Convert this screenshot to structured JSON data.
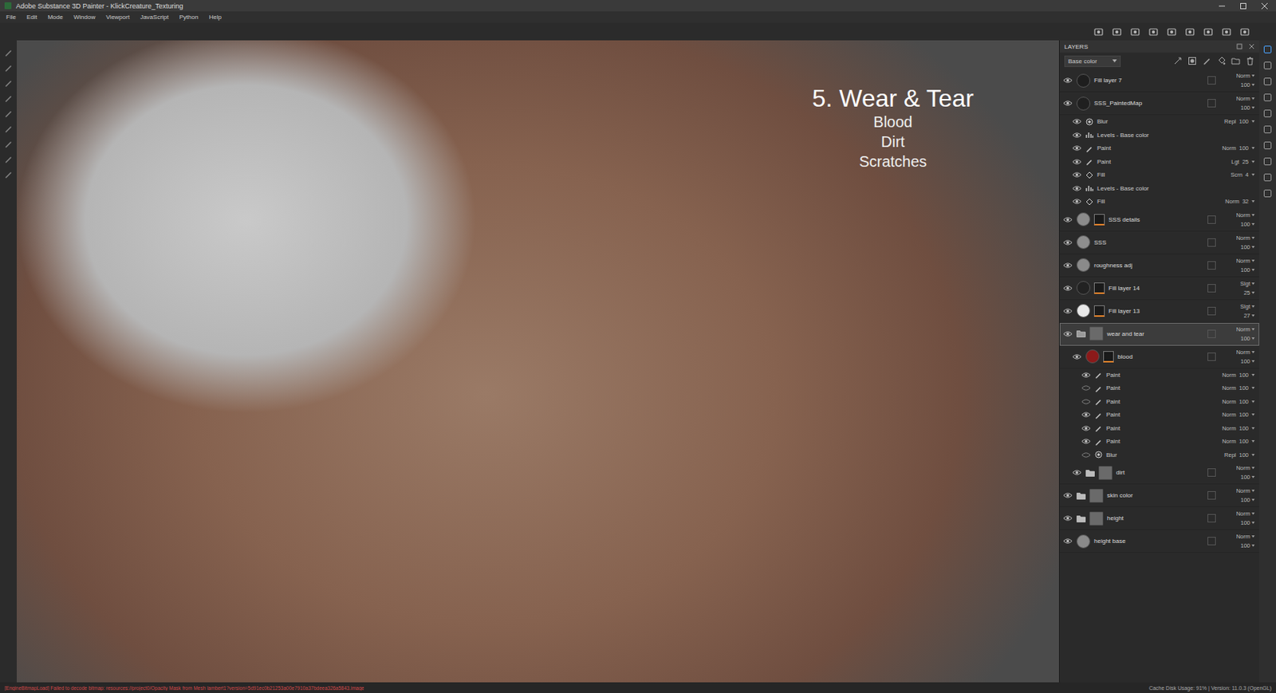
{
  "window": {
    "title": "Adobe Substance 3D Painter - KlickCreature_Texturing"
  },
  "menu": [
    "File",
    "Edit",
    "Mode",
    "Window",
    "Viewport",
    "JavaScript",
    "Python",
    "Help"
  ],
  "viewport": {
    "heading": "5. Wear & Tear",
    "lines": [
      "Blood",
      "Dirt",
      "Scratches"
    ]
  },
  "layers_panel": {
    "title": "LAYERS",
    "channel": "Base color",
    "layers": [
      {
        "name": "Fill layer 7",
        "kind": "fill",
        "visible": true,
        "selected": false,
        "blend": "Norm",
        "opacity": "100",
        "color": "#1e1e1e",
        "mask": false
      },
      {
        "name": "SSS_PaintedMap",
        "kind": "fill",
        "visible": true,
        "selected": false,
        "blend": "Norm",
        "opacity": "100",
        "color": "#202020",
        "mask": false,
        "effects": [
          {
            "name": "Blur",
            "kind": "filter",
            "visible": true,
            "blend": "Repl",
            "opacity": "100"
          },
          {
            "name": "Levels - Base color",
            "kind": "levels",
            "visible": true
          },
          {
            "name": "Paint",
            "kind": "paint",
            "visible": true,
            "blend": "Norm",
            "opacity": "100"
          },
          {
            "name": "Paint",
            "kind": "paint",
            "visible": true,
            "blend": "Lgt",
            "opacity": "25"
          },
          {
            "name": "Fill",
            "kind": "fill",
            "visible": true,
            "blend": "Scrn",
            "opacity": "4"
          },
          {
            "name": "Levels - Base color",
            "kind": "levels",
            "visible": true
          },
          {
            "name": "Fill",
            "kind": "fill",
            "visible": true,
            "blend": "Norm",
            "opacity": "32"
          }
        ]
      },
      {
        "name": "SSS details",
        "kind": "fill",
        "visible": true,
        "selected": false,
        "blend": "Norm",
        "opacity": "100",
        "color": "#8c8c8c",
        "mask": true
      },
      {
        "name": "SSS",
        "kind": "fill",
        "visible": true,
        "selected": false,
        "blend": "Norm",
        "opacity": "100",
        "color": "#8e8e8e",
        "mask": false
      },
      {
        "name": "roughness adj",
        "kind": "fill",
        "visible": true,
        "selected": false,
        "blend": "Norm",
        "opacity": "100",
        "color": "#8a8a8a",
        "mask": false
      },
      {
        "name": "Fill layer 14",
        "kind": "fill",
        "visible": true,
        "selected": false,
        "blend": "Slgt",
        "opacity": "25",
        "color": "#222222",
        "mask": true
      },
      {
        "name": "Fill layer 13",
        "kind": "fill",
        "visible": true,
        "selected": false,
        "blend": "Slgt",
        "opacity": "27",
        "color": "#e8e8e8",
        "mask": true
      },
      {
        "name": "wear and tear",
        "kind": "folder",
        "visible": true,
        "selected": true,
        "blend": "Norm",
        "opacity": "100",
        "color": "#6a6a6a",
        "mask": false,
        "expanded": true,
        "layers": [
          {
            "name": "blood",
            "kind": "fill",
            "visible": true,
            "selected": false,
            "blend": "Norm",
            "opacity": "100",
            "color": "#8b1a1a",
            "mask": true,
            "effects": [
              {
                "name": "Paint",
                "kind": "paint",
                "visible": true,
                "blend": "Norm",
                "opacity": "100"
              },
              {
                "name": "Paint",
                "kind": "paint",
                "visible": false,
                "blend": "Norm",
                "opacity": "100"
              },
              {
                "name": "Paint",
                "kind": "paint",
                "visible": false,
                "blend": "Norm",
                "opacity": "100"
              },
              {
                "name": "Paint",
                "kind": "paint",
                "visible": true,
                "blend": "Norm",
                "opacity": "100"
              },
              {
                "name": "Paint",
                "kind": "paint",
                "visible": true,
                "blend": "Norm",
                "opacity": "100"
              },
              {
                "name": "Paint",
                "kind": "paint",
                "visible": true,
                "blend": "Norm",
                "opacity": "100"
              },
              {
                "name": "Blur",
                "kind": "filter",
                "visible": false,
                "blend": "Repl",
                "opacity": "100"
              }
            ]
          },
          {
            "name": "dirt",
            "kind": "folder",
            "visible": true,
            "selected": false,
            "blend": "Norm",
            "opacity": "100",
            "color": "#6a6a6a",
            "mask": false,
            "expanded": false
          }
        ]
      },
      {
        "name": "skin color",
        "kind": "folder",
        "visible": true,
        "selected": false,
        "blend": "Norm",
        "opacity": "100",
        "color": "#6a6a6a",
        "mask": false,
        "expanded": false
      },
      {
        "name": "height",
        "kind": "folder",
        "visible": true,
        "selected": false,
        "blend": "Norm",
        "opacity": "100",
        "color": "#6a6a6a",
        "mask": false,
        "expanded": false
      },
      {
        "name": "height base",
        "kind": "fill",
        "visible": true,
        "selected": false,
        "blend": "Norm",
        "opacity": "100",
        "color": "#8a8a8a",
        "mask": false
      }
    ]
  },
  "status_bar": {
    "message": "[EngineBitmapLoad] Failed to decode bitmap: resources://project0/Opacity Mask from Mesh lambert1?version=5d91ec0b21253a00e7910a37bdeea326a5843.image",
    "info": "Cache Disk Usage:  91% | Version: 11.0.3 (OpenGL)"
  }
}
